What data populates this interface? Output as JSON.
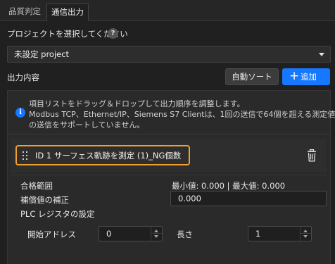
{
  "tabs": [
    {
      "label": "品質判定",
      "active": false
    },
    {
      "label": "通信出力",
      "active": true
    }
  ],
  "project": {
    "label": "プロジェクトを選択してください",
    "help_icon": "?",
    "selected": "未設定 project"
  },
  "output": {
    "label": "出力内容",
    "auto_sort_label": "自動ソート",
    "add_label": "追加",
    "add_icon": "+"
  },
  "info": {
    "icon": "i",
    "lines": [
      "項目リストをドラッグ＆ドロップして出力順序を調整します。",
      "Modbus TCP、Ethernet/IP、Siemens S7 Clientは、1回の送信で64個を超える測定値",
      "の送信をサポートしていません。"
    ]
  },
  "item": {
    "label": "ID 1  サーフェス軌跡を測定 (1)_NG個数"
  },
  "settings": {
    "pass_range_label": "合格範囲",
    "min_max_text": "最小値: 0.000 | 最大値: 0.000",
    "compensation_label": "補償値の補正",
    "compensation_value": "0.000",
    "plc_label": "PLC レジスタの設定",
    "start_address_label": "開始アドレス",
    "start_address_value": "0",
    "length_label": "長さ",
    "length_value": "1"
  },
  "colors": {
    "accent": "#1677ff",
    "highlight": "#f0a030",
    "background": "#202020"
  }
}
